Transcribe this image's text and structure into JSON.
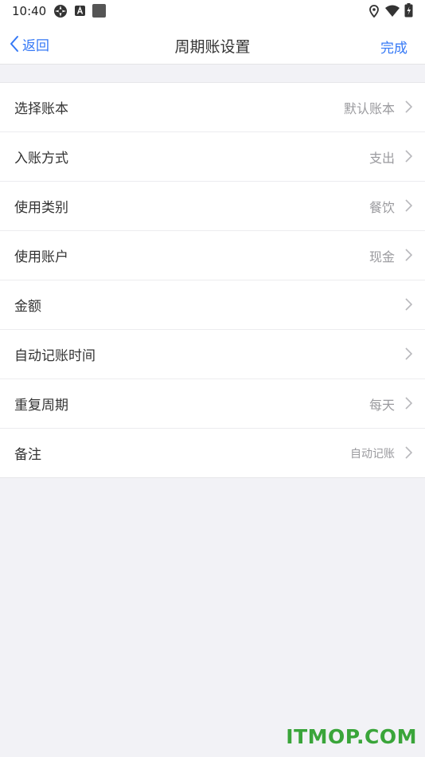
{
  "status_bar": {
    "time": "10:40",
    "left_icons": [
      "photo-rotate-icon",
      "a-badge-icon",
      "square-icon"
    ],
    "right_icons": [
      "location-icon",
      "wifi-icon",
      "battery-icon"
    ]
  },
  "nav": {
    "back_label": "返回",
    "title": "周期账设置",
    "done_label": "完成"
  },
  "rows": [
    {
      "label": "选择账本",
      "value": "默认账本"
    },
    {
      "label": "入账方式",
      "value": "支出"
    },
    {
      "label": "使用类别",
      "value": "餐饮"
    },
    {
      "label": "使用账户",
      "value": "现金"
    },
    {
      "label": "金额",
      "value": ""
    },
    {
      "label": "自动记账时间",
      "value": ""
    },
    {
      "label": "重复周期",
      "value": "每天"
    },
    {
      "label": "备注",
      "value": "自动记账"
    }
  ],
  "watermark": "ITMOP.COM",
  "colors": {
    "accent": "#3478f6",
    "background": "#f2f2f6",
    "value_text": "#9a9a9e",
    "watermark": "#3aa53a"
  }
}
